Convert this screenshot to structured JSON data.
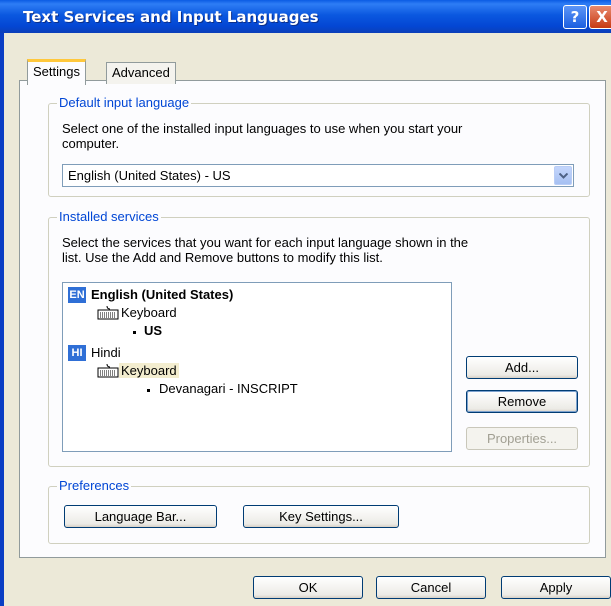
{
  "window": {
    "title": "Text Services and Input Languages",
    "help_glyph": "?",
    "close_glyph": "X"
  },
  "tabs": [
    {
      "label": "Settings",
      "active": true
    },
    {
      "label": "Advanced",
      "active": false
    }
  ],
  "default_language": {
    "legend": "Default input language",
    "description_line1": "Select one of the installed input languages to use when you start your",
    "description_line2": "computer.",
    "selected": "English (United States) - US"
  },
  "installed_services": {
    "legend": "Installed services",
    "description_line1": "Select the services that you want for each input language shown in the",
    "description_line2": "list. Use the Add and Remove buttons to modify this list.",
    "languages": [
      {
        "badge": "EN",
        "name": "English (United States)",
        "service": "Keyboard",
        "layout": "US"
      },
      {
        "badge": "HI",
        "name": "Hindi",
        "service": "Keyboard",
        "layout": "Devanagari - INSCRIPT"
      }
    ],
    "buttons": {
      "add": "Add...",
      "remove": "Remove",
      "properties": "Properties..."
    }
  },
  "preferences": {
    "legend": "Preferences",
    "language_bar": "Language Bar...",
    "key_settings": "Key Settings..."
  },
  "footer": {
    "ok": "OK",
    "cancel": "Cancel",
    "apply": "Apply"
  },
  "colors": {
    "title_bar": "#0B58E0",
    "group_legend": "#0046D5",
    "badge": "#2F6FD6",
    "selection": "#F3EDCF"
  }
}
